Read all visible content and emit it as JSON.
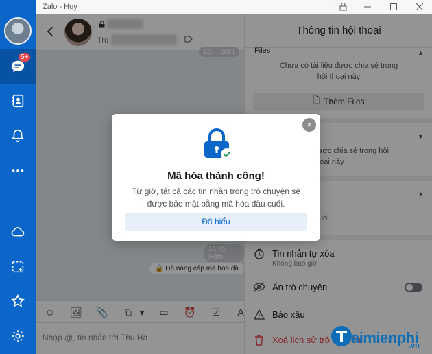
{
  "window": {
    "title": "Zalo - Huy"
  },
  "nav": {
    "badge": "5+"
  },
  "chat": {
    "contact_prefix": "Tru",
    "time_pill_top": "12:... 2021",
    "time_pill_bottom": "16:45 Hôm",
    "system_message": "Đã nâng cấp mã hóa đầ",
    "input_placeholder": "Nhập @, tin nhắn tới Thu Hà"
  },
  "panel": {
    "title": "Thông tin hội thoại",
    "files_label": "Files",
    "files_empty_line1": "Chưa có tài liệu được chia sẻ trong",
    "files_empty_line2": "hội thoại này",
    "add_files_label": "Thêm Files",
    "links_empty_line1": "được chia sẻ trong hội",
    "links_empty_line2": "thoại này",
    "auto_delete_label": "Tin nhắn tự xóa",
    "auto_delete_sub": "Không bao giờ",
    "hide_chat_label": "Ẩn trò chuyện",
    "report_label": "Báo xấu",
    "delete_history_label": "Xoá lịch sử trò chuyện",
    "partial_text": "uối"
  },
  "modal": {
    "title": "Mã hóa thành công!",
    "text": "Từ giờ, tất cả các tin nhắn trong trò chuyện sẽ được bảo mật bằng mã hóa đầu cuối.",
    "button_label": "Đã hiểu"
  },
  "watermark": {
    "brand": "aimienphi",
    "sub": ".vn"
  },
  "colors": {
    "nav": "#0a66c8",
    "accent": "#0a66c8",
    "danger": "#e5484d"
  }
}
